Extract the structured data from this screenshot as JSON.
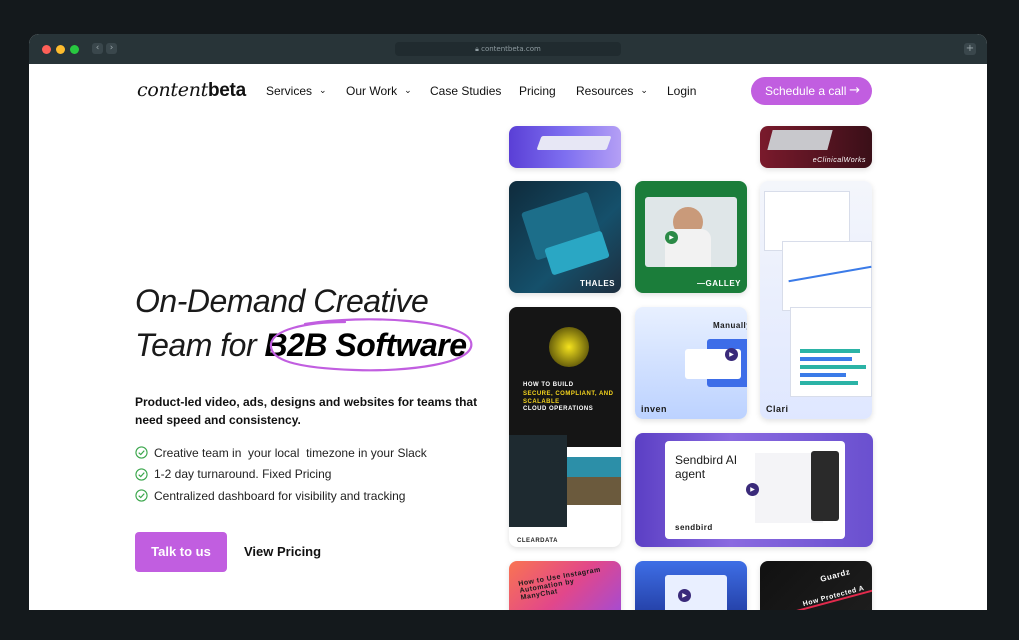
{
  "browser": {
    "url": "contentbeta.com",
    "back_glyph": "‹",
    "forward_glyph": "›",
    "newtab_glyph": "+"
  },
  "header": {
    "logo_light": "content",
    "logo_bold": "beta",
    "nav": [
      {
        "label": "Services",
        "dropdown": true
      },
      {
        "label": "Our Work",
        "dropdown": true
      },
      {
        "label": "Case Studies",
        "dropdown": false
      },
      {
        "label": "Pricing",
        "dropdown": false
      },
      {
        "label": "Resources",
        "dropdown": true
      },
      {
        "label": "Login",
        "dropdown": false
      }
    ],
    "chevron_glyph": "⌄",
    "cta_label": "Schedule a call",
    "cta_arrow": "→"
  },
  "hero": {
    "headline_line1": "On-Demand Creative",
    "headline_line2_prefix": "Team for ",
    "headline_highlight": "B2B Software",
    "subheading": "Product-led video, ads, designs and websites for teams that need speed and consistency.",
    "features": [
      "Creative team in  your local  timezone in your Slack",
      "1-2 day turnaround. Fixed Pricing",
      "Centralized dashboard for visibility and tracking"
    ],
    "primary_button": "Talk to us",
    "secondary_link": "View Pricing"
  },
  "gallery": {
    "captions": {
      "eclinical": "eClinicalWorks",
      "thales": "THALES",
      "galley": "—GALLEY",
      "manually": "Manually",
      "inven": "inven",
      "clari": "Clari",
      "cleardata": "CLEARDATA",
      "cleardata_title": "HOW TO BUILD",
      "cleardata_highlight": "SECURE, COMPLIANT, AND SCALABLE",
      "cleardata_tail": "CLOUD OPERATIONS",
      "sendbird_title": "Sendbird AI agent",
      "sendbird_logo": "sendbird",
      "insta_title": "How to Use Instagram Automation by ManyChat",
      "guardz_logo": "Guardz",
      "guardz_title": "How Protected A",
      "play_glyph": "▶"
    }
  },
  "colors": {
    "accent": "#c15ee0",
    "chrome": "#283438",
    "backdrop": "#14191c",
    "check": "#3aa64b"
  }
}
